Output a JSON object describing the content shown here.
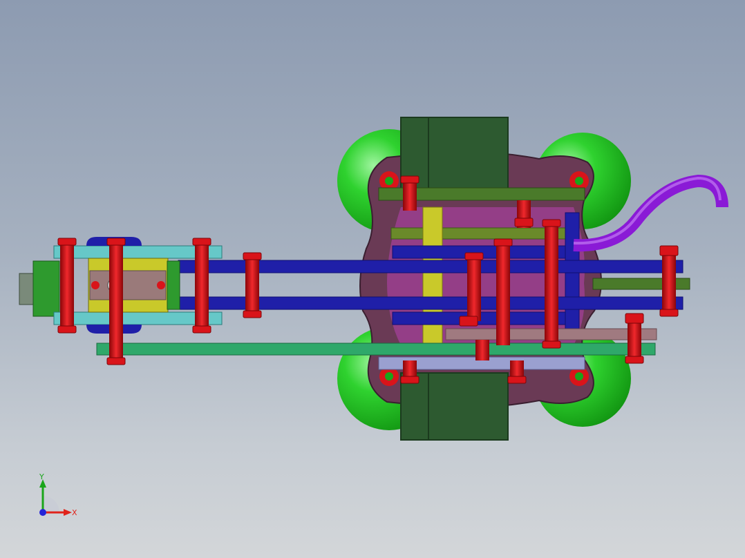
{
  "viewport": {
    "background_top": "#8d9bb1",
    "background_bottom": "#d3d6d9"
  },
  "triad": {
    "x_label": "X",
    "y_label": "Y",
    "x_color": "#e0231b",
    "y_color": "#1aa51a",
    "z_color": "#2424d8"
  },
  "model": {
    "colors": {
      "plate_blue": "#1f1fa8",
      "pin_red": "#d9141a",
      "tube_purple": "#8a1ad6",
      "wheel_green": "#22c422",
      "block_dark_green": "#2d5a30",
      "housing_plum": "#6a3a55",
      "housing_purple": "#9b3f90",
      "link_cyan": "#66c8c8",
      "link_teal_green": "#2fa86a",
      "link_olive": "#4a7a2a",
      "link_mauve": "#a07a80",
      "link_lavender": "#9aa0d0",
      "block_yellow": "#c9c92a"
    }
  }
}
